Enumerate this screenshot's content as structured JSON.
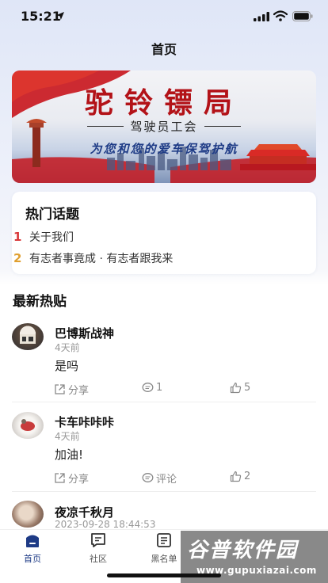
{
  "status_bar": {
    "time": "15:21"
  },
  "header": {
    "title": "首页"
  },
  "banner": {
    "title": "驼铃镖局",
    "subtitle": "驾驶员工会",
    "slogan": "为您和您的爱车保驾护航"
  },
  "hot_topics": {
    "title": "热门话题",
    "items": [
      {
        "rank": "1",
        "text": "关于我们",
        "color": "#d9383a"
      },
      {
        "rank": "2",
        "text": "有志者事竟成 · 有志者跟我来",
        "color": "#e0a030"
      }
    ]
  },
  "latest": {
    "title": "最新热贴",
    "posts": [
      {
        "name": "巴博斯战神",
        "time": "4天前",
        "content": "是吗",
        "share": "分享",
        "comments": "1",
        "likes": "5"
      },
      {
        "name": "卡车咔咔咔",
        "time": "4天前",
        "content": "加油!",
        "share": "分享",
        "comments": "评论",
        "likes": "2"
      },
      {
        "name": "夜凉千秋月",
        "time": "2023-09-28 18:44:53"
      }
    ]
  },
  "tabbar": {
    "tabs": [
      {
        "label": "首页",
        "icon": "home-icon",
        "active": true
      },
      {
        "label": "社区",
        "icon": "chat-icon",
        "active": false
      },
      {
        "label": "黑名单",
        "icon": "list-icon",
        "active": false
      }
    ]
  },
  "watermark": {
    "brand": "谷普软件园",
    "url": "www.gupuxiazai.com"
  },
  "colors": {
    "accent": "#1e3b86",
    "banner_red": "#b31218",
    "rank1": "#d9383a",
    "rank2": "#e0a030"
  }
}
